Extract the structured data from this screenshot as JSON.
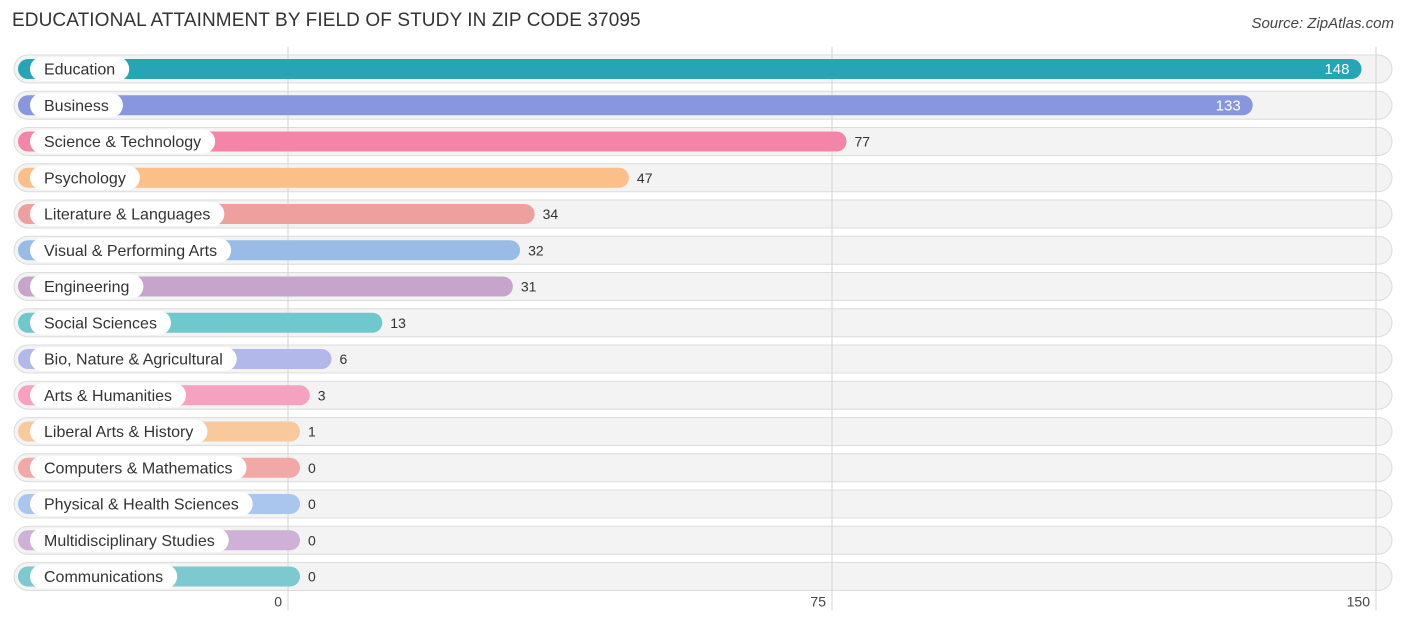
{
  "header": {
    "title": "EDUCATIONAL ATTAINMENT BY FIELD OF STUDY IN ZIP CODE 37095",
    "source": "Source: ZipAtlas.com"
  },
  "chart_data": {
    "type": "bar",
    "orientation": "horizontal",
    "title": "EDUCATIONAL ATTAINMENT BY FIELD OF STUDY IN ZIP CODE 37095",
    "xlabel": "",
    "ylabel": "",
    "xlim": [
      0,
      150
    ],
    "xticks": [
      0,
      75,
      150
    ],
    "tick_labels": [
      "0",
      "75",
      "150"
    ],
    "grid": true,
    "categories": [
      "Education",
      "Business",
      "Science & Technology",
      "Psychology",
      "Literature & Languages",
      "Visual & Performing Arts",
      "Engineering",
      "Social Sciences",
      "Bio, Nature & Agricultural",
      "Arts & Humanities",
      "Liberal Arts & History",
      "Computers & Mathematics",
      "Physical & Health Sciences",
      "Multidisciplinary Studies",
      "Communications"
    ],
    "values": [
      148,
      133,
      77,
      47,
      34,
      32,
      31,
      13,
      6,
      3,
      1,
      0,
      0,
      0,
      0
    ],
    "colors": [
      "#26a6b4",
      "#8896e0",
      "#f484a8",
      "#fbc08a",
      "#eda09e",
      "#98bce6",
      "#c6a4cc",
      "#6fc8cc",
      "#b3b8ea",
      "#f4a2c0",
      "#f9c99e",
      "#f2a8a6",
      "#a8c6ee",
      "#cfb0d6",
      "#7ccad0"
    ]
  }
}
